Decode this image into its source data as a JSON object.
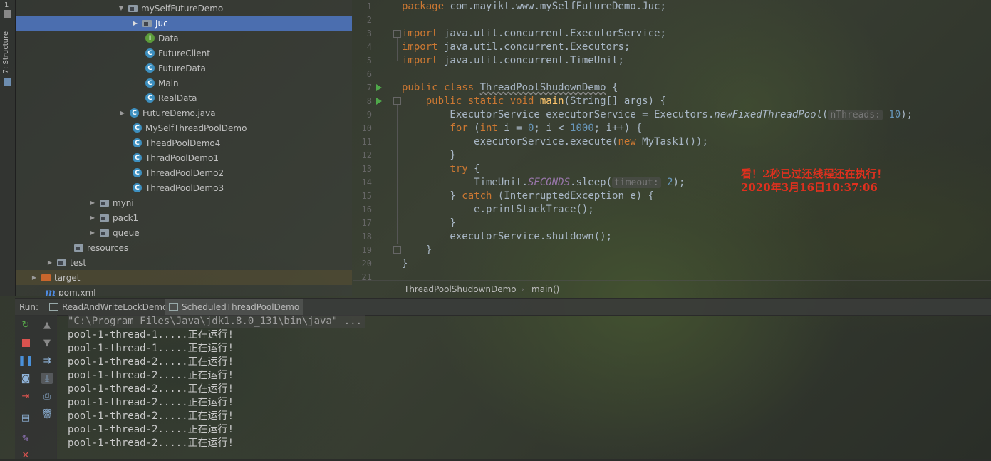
{
  "colors": {
    "selection": "#4b6eaf",
    "keyword": "#cc7832",
    "function": "#ffc66d",
    "number": "#6897bb",
    "annotation": "#e0301e",
    "run_marker": "#4fa84a"
  },
  "toolstrip": {
    "structure_label": "7: Structure",
    "top_label": "1"
  },
  "tree": {
    "items": [
      {
        "label": "mySelfFutureDemo",
        "icon": "folder-icon",
        "arrow": "▼"
      },
      {
        "label": "Juc",
        "icon": "folder-icon",
        "arrow": "▶"
      },
      {
        "label": "Data",
        "icon": "interface-icon",
        "glyph": "I"
      },
      {
        "label": "FutureClient",
        "icon": "class-icon",
        "glyph": "C"
      },
      {
        "label": "FutureData",
        "icon": "class-icon",
        "glyph": "C"
      },
      {
        "label": "Main",
        "icon": "class-icon",
        "glyph": "C"
      },
      {
        "label": "RealData",
        "icon": "class-icon",
        "glyph": "C"
      },
      {
        "label": "FutureDemo.java",
        "icon": "class-icon",
        "glyph": "C",
        "arrow": "▶"
      },
      {
        "label": "MySelfThreadPoolDemo",
        "icon": "class-icon",
        "glyph": "C"
      },
      {
        "label": "TheadPoolDemo4",
        "icon": "class-icon",
        "glyph": "C"
      },
      {
        "label": "ThradPoolDemo1",
        "icon": "class-icon",
        "glyph": "C"
      },
      {
        "label": "ThreadPoolDemo2",
        "icon": "class-icon",
        "glyph": "C"
      },
      {
        "label": "ThreadPoolDemo3",
        "icon": "class-icon",
        "glyph": "C"
      },
      {
        "label": "myni",
        "icon": "folder-icon",
        "arrow": "▶"
      },
      {
        "label": "pack1",
        "icon": "folder-icon",
        "arrow": "▶"
      },
      {
        "label": "queue",
        "icon": "folder-icon",
        "arrow": "▶"
      },
      {
        "label": "resources",
        "icon": "folder-icon"
      },
      {
        "label": "test",
        "icon": "folder-icon",
        "arrow": "▶"
      },
      {
        "label": "target",
        "icon": "folder-icon",
        "arrow": "▶"
      },
      {
        "label": "pom.xml",
        "icon": "maven-icon",
        "glyph": "m"
      }
    ]
  },
  "editor": {
    "line_numbers": [
      "1",
      "2",
      "3",
      "4",
      "5",
      "6",
      "7",
      "8",
      "9",
      "10",
      "11",
      "12",
      "13",
      "14",
      "15",
      "16",
      "17",
      "18",
      "19",
      "20",
      "21"
    ],
    "code": {
      "l1_kw": "package",
      "l1_rest": " com.mayikt.www.mySelfFutureDemo.Juc;",
      "l3_kw": "import",
      "l3_rest": " java.util.concurrent.ExecutorService;",
      "l4_kw": "import",
      "l4_rest": " java.util.concurrent.Executors;",
      "l5_kw": "import",
      "l5_rest": " java.util.concurrent.TimeUnit;",
      "l7_kw": "public class",
      "l7_name": "ThreadPoolShudownDemo",
      "l7_rest": " {",
      "l8_kw": "    public static void",
      "l8_fn": "main",
      "l8_rest": "(String[] args) {",
      "l9_a": "        ExecutorService executorService = Executors.",
      "l9_fn": "newFixedThreadPool",
      "l9_paren": "(",
      "l9_hint": "nThreads:",
      "l9_num": "10",
      "l9_end": ");",
      "l10_kw1": "        for",
      "l10_a": " (",
      "l10_kw2": "int",
      "l10_b": " i = ",
      "l10_n1": "0",
      "l10_c": "; i < ",
      "l10_n2": "1000",
      "l10_d": "; i++) {",
      "l11_a": "            executorService.execute(",
      "l11_kw": "new",
      "l11_b": " MyTask1());",
      "l12": "        }",
      "l13_kw": "        try",
      "l13_rest": " {",
      "l14_a": "            TimeUnit.",
      "l14_field": "SECONDS",
      "l14_b": ".sleep(",
      "l14_hint": "timeout:",
      "l14_num": "2",
      "l14_end": ");",
      "l15_a": "        } ",
      "l15_kw": "catch",
      "l15_b": " (InterruptedException e) {",
      "l16": "            e.printStackTrace();",
      "l17": "        }",
      "l18": "        executorService.shutdown();",
      "l19": "    }",
      "l20": "}"
    },
    "breadcrumb": [
      "ThreadPoolShudownDemo",
      "main()"
    ],
    "annotation": [
      "看！2秒已过还线程还在执行！",
      "2020年3月16日10:37:06"
    ]
  },
  "run": {
    "label": "Run:",
    "tabs": [
      "ReadAndWriteLockDemo",
      "ScheduledThreadPoolDemo"
    ],
    "tools_left": [
      "rerun-icon",
      "stop-icon",
      "pause-icon",
      "camera-icon",
      "login-icon",
      "layout-icon",
      "pin-icon",
      "close-icon"
    ],
    "tools_right": [
      "up-arrow-icon",
      "down-arrow-icon",
      "soft-wrap-icon",
      "scroll-to-end-icon",
      "print-icon",
      "trash-icon"
    ],
    "console_lines": [
      "\"C:\\Program Files\\Java\\jdk1.8.0_131\\bin\\java\" ...",
      "pool-1-thread-1.....正在运行!",
      "pool-1-thread-1.....正在运行!",
      "pool-1-thread-2.....正在运行!",
      "pool-1-thread-2.....正在运行!",
      "pool-1-thread-2.....正在运行!",
      "pool-1-thread-2.....正在运行!",
      "pool-1-thread-2.....正在运行!",
      "pool-1-thread-2.....正在运行!",
      "pool-1-thread-2.....正在运行!"
    ]
  }
}
